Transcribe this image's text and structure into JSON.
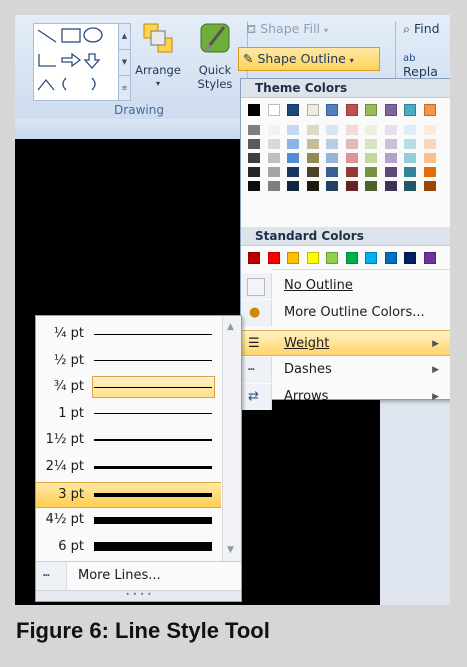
{
  "ribbon": {
    "arrange_label": "Arrange",
    "quick_styles_label_1": "Quick",
    "quick_styles_label_2": "Styles",
    "group_label": "Drawing",
    "shape_fill_label": "Shape Fill",
    "shape_outline_label": "Shape Outline",
    "find_label": "Find",
    "replace_label": "Repla"
  },
  "color_menu": {
    "theme_header": "Theme Colors",
    "standard_header": "Standard Colors",
    "theme_colors": [
      "#000000",
      "#ffffff",
      "#1f497d",
      "#eeece1",
      "#4f81bd",
      "#c0504d",
      "#9bbb59",
      "#8064a2",
      "#4bacc6",
      "#f79646"
    ],
    "theme_shades": [
      [
        "#7f7f7f",
        "#595959",
        "#3f3f3f",
        "#262626",
        "#0c0c0c"
      ],
      [
        "#f2f2f2",
        "#d8d8d8",
        "#bfbfbf",
        "#a5a5a5",
        "#7f7f7f"
      ],
      [
        "#c6d9f0",
        "#8db3e2",
        "#548dd4",
        "#17365d",
        "#0f243e"
      ],
      [
        "#ddd9c3",
        "#c4bd97",
        "#938953",
        "#494429",
        "#1d1b10"
      ],
      [
        "#dbe5f1",
        "#b8cce4",
        "#95b3d7",
        "#366092",
        "#244061"
      ],
      [
        "#f2dcdb",
        "#e5b9b7",
        "#d99694",
        "#953734",
        "#632423"
      ],
      [
        "#ebf1dd",
        "#d7e3bc",
        "#c3d69b",
        "#76923c",
        "#4f6128"
      ],
      [
        "#e5e0ec",
        "#ccc1d9",
        "#b2a2c7",
        "#5f497a",
        "#3f3151"
      ],
      [
        "#dbeef3",
        "#b7dde8",
        "#92cddc",
        "#31859b",
        "#205867"
      ],
      [
        "#fdeada",
        "#fbd5b5",
        "#fac08f",
        "#e36c09",
        "#974806"
      ]
    ],
    "standard_colors": [
      "#c00000",
      "#ff0000",
      "#ffc000",
      "#ffff00",
      "#92d050",
      "#00b050",
      "#00b0f0",
      "#0070c0",
      "#002060",
      "#7030a0"
    ],
    "no_outline": "No Outline",
    "more_colors": "More Outline Colors...",
    "weight": "Weight",
    "dashes": "Dashes",
    "arrows": "Arrows"
  },
  "weight_menu": {
    "items": [
      {
        "label": "¼ pt",
        "weight": 0.25
      },
      {
        "label": "½ pt",
        "weight": 0.5
      },
      {
        "label": "¾ pt",
        "weight": 0.75
      },
      {
        "label": "1 pt",
        "weight": 1
      },
      {
        "label": "1½ pt",
        "weight": 1.5
      },
      {
        "label": "2¼ pt",
        "weight": 2.25
      },
      {
        "label": "3 pt",
        "weight": 3
      },
      {
        "label": "4½ pt",
        "weight": 4.5
      },
      {
        "label": "6 pt",
        "weight": 6
      }
    ],
    "hovered_index": 2,
    "selected_index": 6,
    "more_lines": "More Lines..."
  },
  "caption": "Figure 6: Line Style Tool"
}
